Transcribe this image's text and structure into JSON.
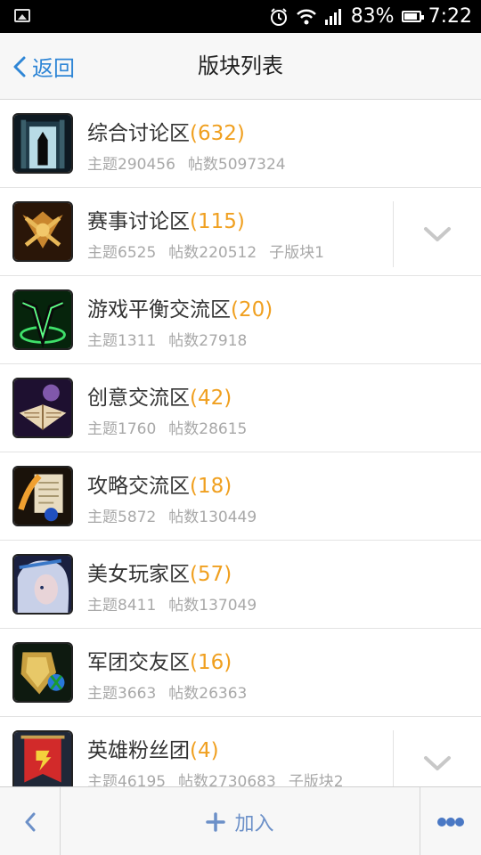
{
  "status_bar": {
    "battery": "83%",
    "time": "7:22"
  },
  "header": {
    "back_label": "返回",
    "title": "版块列表"
  },
  "forums": [
    {
      "name": "综合讨论区",
      "count": "(632)",
      "topics": "主题290456",
      "posts": "帖数5097324",
      "sub": "",
      "expandable": false,
      "icon": "hero-gate-icon"
    },
    {
      "name": "赛事讨论区",
      "count": "(115)",
      "topics": "主题6525",
      "posts": "帖数220512",
      "sub": "子版块1",
      "expandable": true,
      "icon": "trophy-crest-icon"
    },
    {
      "name": "游戏平衡交流区",
      "count": "(20)",
      "topics": "主题1311",
      "posts": "帖数27918",
      "sub": "",
      "expandable": false,
      "icon": "balance-rune-icon"
    },
    {
      "name": "创意交流区",
      "count": "(42)",
      "topics": "主题1760",
      "posts": "帖数28615",
      "sub": "",
      "expandable": false,
      "icon": "magic-book-icon"
    },
    {
      "name": "攻略交流区",
      "count": "(18)",
      "topics": "主题5872",
      "posts": "帖数130449",
      "sub": "",
      "expandable": false,
      "icon": "scroll-quill-icon"
    },
    {
      "name": "美女玩家区",
      "count": "(57)",
      "topics": "主题8411",
      "posts": "帖数137049",
      "sub": "",
      "expandable": false,
      "icon": "girl-portrait-icon"
    },
    {
      "name": "军团交友区",
      "count": "(16)",
      "topics": "主题3663",
      "posts": "帖数26363",
      "sub": "",
      "expandable": false,
      "icon": "guild-shield-icon"
    },
    {
      "name": "英雄粉丝团",
      "count": "(4)",
      "topics": "主题46195",
      "posts": "帖数2730683",
      "sub": "子版块2",
      "expandable": true,
      "icon": "fan-banner-icon"
    }
  ],
  "bottom_bar": {
    "join_label": "加入"
  },
  "colors": {
    "accent": "#2f86d6",
    "count": "#f0a020",
    "meta": "#a8a8a8"
  }
}
